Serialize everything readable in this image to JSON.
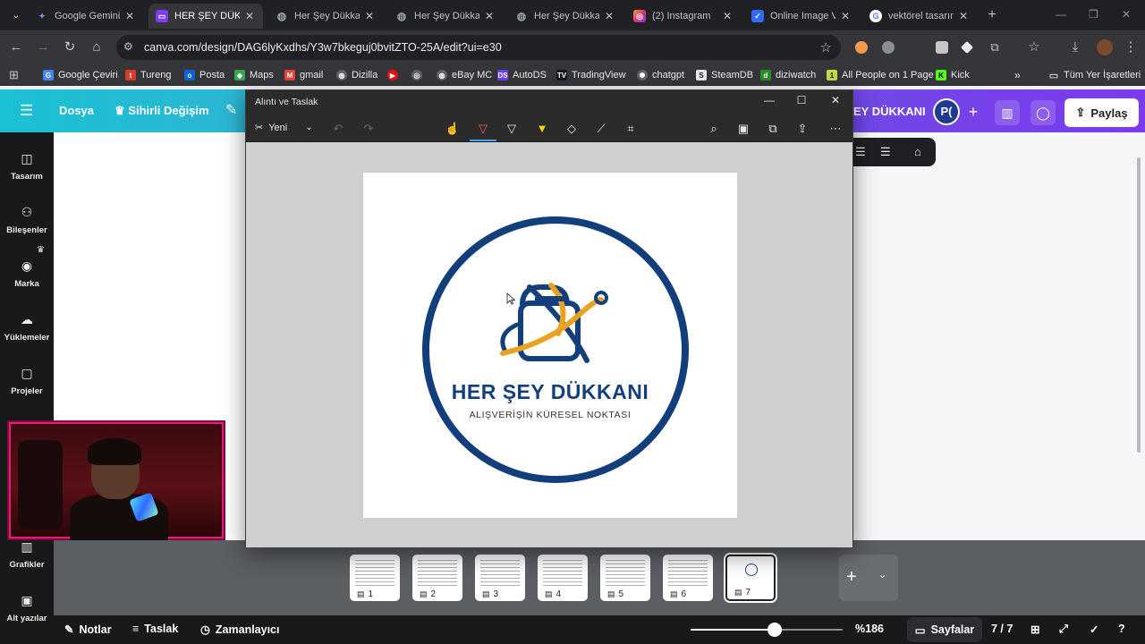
{
  "browser": {
    "tabs": [
      {
        "label": "Google Gemini",
        "icon": "gemini-icon",
        "color": "#7b8cff",
        "active": false
      },
      {
        "label": "HER ŞEY DÜKKANI",
        "icon": "canva-icon",
        "color": "#7d3cff",
        "active": true
      },
      {
        "label": "Her Şey Dükkanı",
        "icon": "globe-icon",
        "color": "#9aa0a6",
        "active": false
      },
      {
        "label": "Her Şey Dükkanı",
        "icon": "globe-icon",
        "color": "#9aa0a6",
        "active": false
      },
      {
        "label": "Her Şey Dükkanı",
        "icon": "globe-icon",
        "color": "#9aa0a6",
        "active": false
      },
      {
        "label": "(2) Instagram",
        "icon": "instagram-icon",
        "color": "#e1306c",
        "active": false
      },
      {
        "label": "Online Image Ve",
        "icon": "check-icon",
        "color": "#2f6bff",
        "active": false
      },
      {
        "label": "vektörel tasarım",
        "icon": "google-icon",
        "color": "#4285f4",
        "active": false
      }
    ],
    "url": "canva.com/design/DAG6lyKxdhs/Y3w7bkeguj0bvitZTO-25A/edit?ui=e30",
    "bookmarks": [
      {
        "label": "Google Çeviri",
        "color": "#4285f4",
        "icon": "translate-icon"
      },
      {
        "label": "Tureng",
        "color": "#d83b2b",
        "icon": "tureng-icon"
      },
      {
        "label": "Posta",
        "color": "#0a64d6",
        "icon": "outlook-icon"
      },
      {
        "label": "Maps",
        "color": "#34a853",
        "icon": "maps-icon"
      },
      {
        "label": "gmail",
        "color": "#ea4335",
        "icon": "gmail-icon"
      },
      {
        "label": "Dizilla",
        "color": "#bdc1c6",
        "icon": "globe-icon"
      },
      {
        "label": "",
        "color": "#ff0000",
        "icon": "youtube-icon"
      },
      {
        "label": "",
        "color": "#bdc1c6",
        "icon": "target-icon"
      },
      {
        "label": "eBay MC",
        "color": "#bdc1c6",
        "icon": "globe-icon"
      },
      {
        "label": "AutoDS",
        "color": "#6b3df2",
        "icon": "autods-icon"
      },
      {
        "label": "TradingView",
        "color": "#131722",
        "icon": "tradingview-icon"
      },
      {
        "label": "chatgpt",
        "color": "#bdc1c6",
        "icon": "openai-icon"
      },
      {
        "label": "SteamDB",
        "color": "#e8eaed",
        "icon": "steam-icon"
      },
      {
        "label": "diziwatch",
        "color": "#2a8f2a",
        "icon": "diziwatch-icon"
      },
      {
        "label": "All People on 1 Page",
        "color": "#c8d84a",
        "icon": "page-icon"
      },
      {
        "label": "Kick",
        "color": "#53fc18",
        "icon": "kick-icon"
      },
      {
        "label": "Tüm Yer İşaretleri",
        "color": "#bdc1c6",
        "icon": "folder-icon"
      }
    ]
  },
  "canva": {
    "file_label": "Dosya",
    "magic_label": "Sihirli Değişim",
    "design_title": "EY DÜKKANI",
    "avatar_initials": "P(",
    "share_label": "Paylaş",
    "sidebar": [
      {
        "label": "Tasarım",
        "icon": "layout-icon"
      },
      {
        "label": "Bileşenler",
        "icon": "shapes-icon"
      },
      {
        "label": "Marka",
        "icon": "brand-icon"
      },
      {
        "label": "Yüklemeler",
        "icon": "cloud-upload-icon"
      },
      {
        "label": "Projeler",
        "icon": "folder-icon"
      },
      {
        "label": "Grafikler",
        "icon": "chart-icon"
      },
      {
        "label": "Alt yazılar",
        "icon": "captions-icon"
      }
    ],
    "pages": [
      {
        "number": "1"
      },
      {
        "number": "2"
      },
      {
        "number": "3"
      },
      {
        "number": "4"
      },
      {
        "number": "5"
      },
      {
        "number": "6"
      },
      {
        "number": "7"
      }
    ],
    "selected_page": 7,
    "bottom": {
      "notes_label": "Notlar",
      "outline_label": "Taslak",
      "timer_label": "Zamanlayıcı",
      "zoom_label": "%186",
      "zoom_level": 0.55,
      "pages_label": "Sayfalar",
      "page_counter": "7 / 7"
    }
  },
  "snipping_tool": {
    "title": "Alıntı ve Taslak",
    "new_label": "Yeni",
    "logo": {
      "name": "HER ŞEY DÜKKANI",
      "tagline": "ALIŞVERİŞİN KÜRESEL NOKTASI",
      "primary_color": "#143f7d",
      "accent_color": "#e8a322"
    }
  }
}
